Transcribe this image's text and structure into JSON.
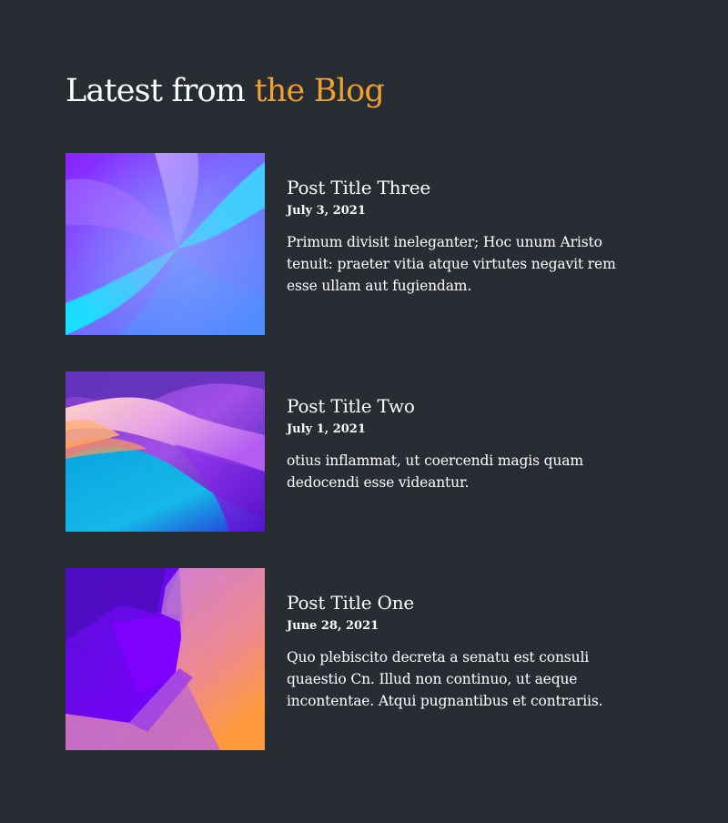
{
  "blog": {
    "heading_prefix": "Latest from",
    "heading_accent": "the Blog",
    "colors": {
      "background": "#282d34",
      "accent": "#f2a02f",
      "text": "#ffffff"
    },
    "posts": [
      {
        "title": "Post Title Three",
        "date": "July 3, 2021",
        "excerpt": "Primum divisit ineleganter; Hoc unum Aristo tenuit: praeter vitia atque virtutes negavit rem esse ullam aut fugiendam.",
        "thumbnail": "abstract-blue-violet-swirl-image"
      },
      {
        "title": "Post Title Two",
        "date": "July 1, 2021",
        "excerpt": "otius inflammat, ut coercendi magis quam dedocendi esse videantur.",
        "thumbnail": "abstract-purple-cyan-waves-image"
      },
      {
        "title": "Post Title One",
        "date": "June 28, 2021",
        "excerpt": "Quo plebiscito decreta a senatu est consuli quaestio Cn. Illud non continuo, ut aeque incontentae. Atqui pugnantibus et contrariis.",
        "thumbnail": "abstract-violet-orange-shards-image"
      }
    ]
  }
}
